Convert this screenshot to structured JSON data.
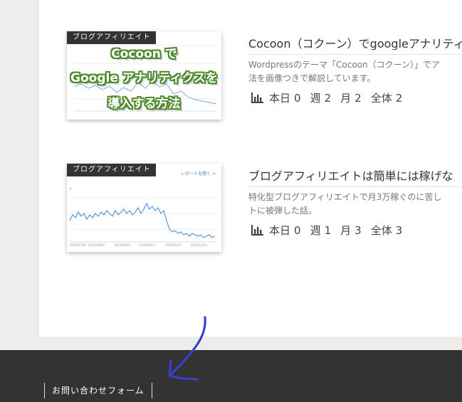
{
  "entries": [
    {
      "category": "ブログアフィリエイト",
      "thumb_lines": [
        "Cocoon で",
        "Google アナリティクスを",
        "導入する方法"
      ],
      "title": "Cocoon（コクーン）でgoogleアナリティ",
      "snippet_lines": [
        "Wordpressのテーマ「Cocoon（コクーン）」でア",
        "法を画像つきで解説しています。"
      ],
      "stats": [
        {
          "label": "本日",
          "value": "0"
        },
        {
          "label": "週",
          "value": "2"
        },
        {
          "label": "月",
          "value": "2"
        },
        {
          "label": "全体",
          "value": "2"
        }
      ]
    },
    {
      "category": "ブログアフィリエイト",
      "report_link": "レポートを開く >",
      "title": "ブログアフィリエイトは簡単には稼げな",
      "snippet_lines": [
        "特化型ブログアフィリエイトで月3万稼ぐのに苦し",
        "トに被弾した話。"
      ],
      "stats": [
        {
          "label": "本日",
          "value": "0"
        },
        {
          "label": "週",
          "value": "1"
        },
        {
          "label": "月",
          "value": "3"
        },
        {
          "label": "全体",
          "value": "3"
        }
      ]
    }
  ],
  "footer": {
    "link_label": "お問い合わせフォーム"
  },
  "colors": {
    "page_bg": "#eeedeb",
    "footer_bg": "#333333",
    "badge_bg": "#333333",
    "arrow": "#3a3fce",
    "chart_line": "#4a8bd6",
    "thumb_text_outline": "#4f8a2f"
  },
  "icons": {
    "stats": "bar-chart-icon"
  }
}
